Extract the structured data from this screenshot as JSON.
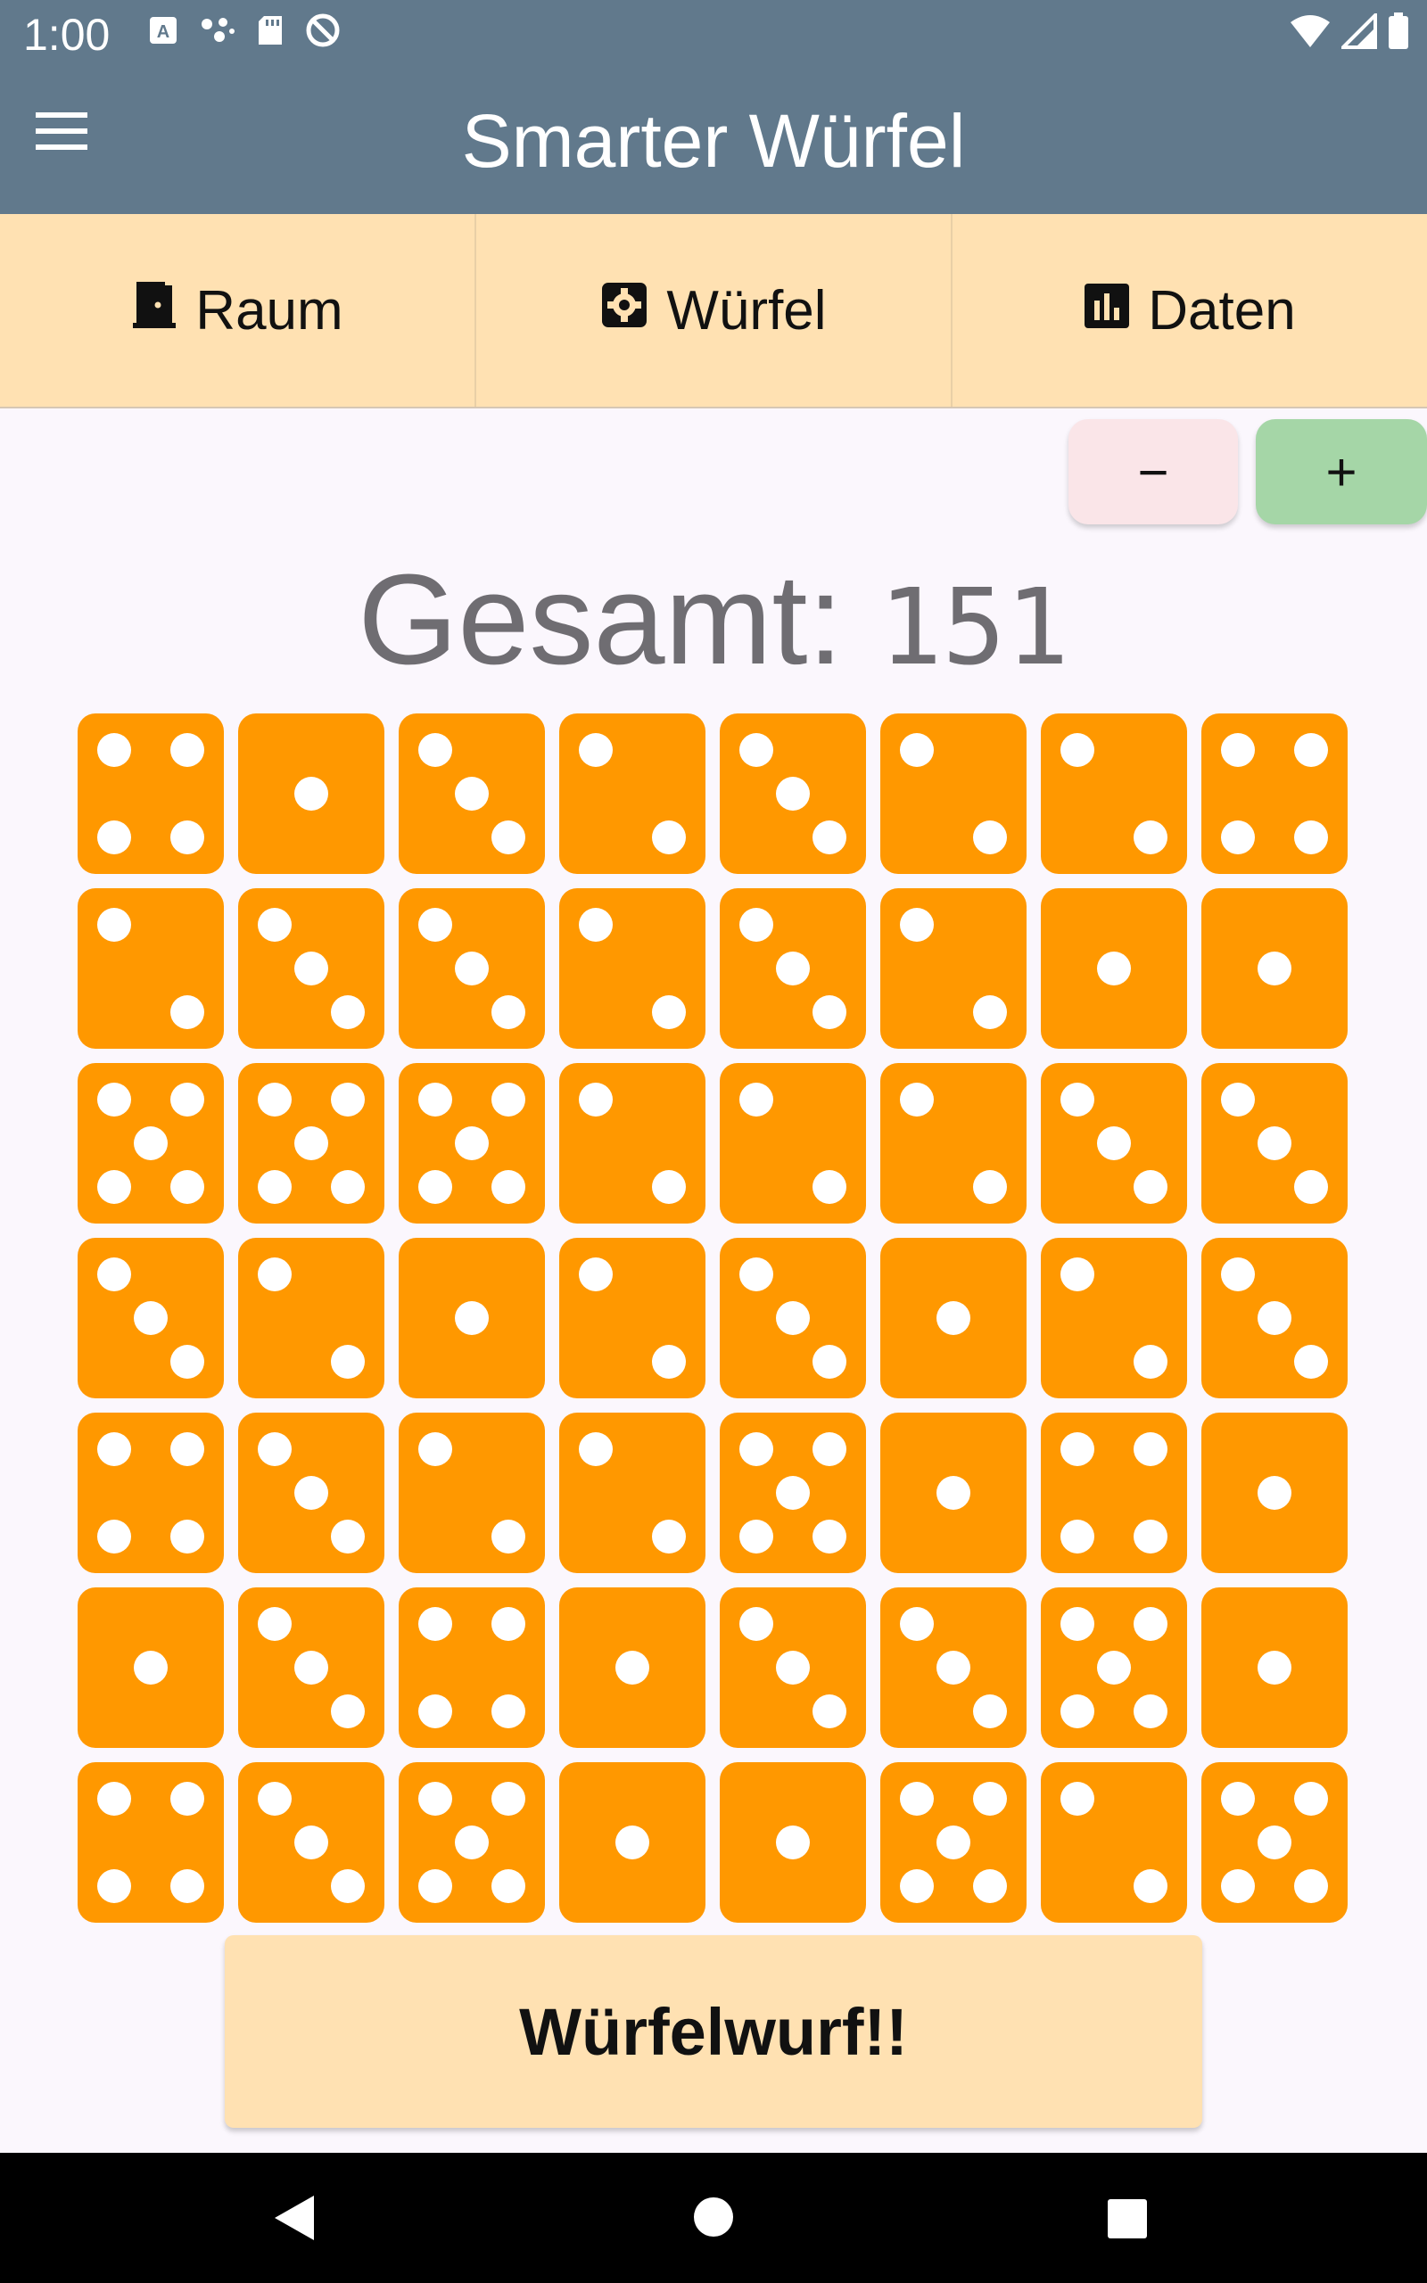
{
  "status_bar": {
    "time": "1:00"
  },
  "app_bar": {
    "title": "Smarter Würfel"
  },
  "tabs": [
    {
      "label": "Raum",
      "icon": "door-icon"
    },
    {
      "label": "Würfel",
      "icon": "die-gear-icon"
    },
    {
      "label": "Daten",
      "icon": "bar-chart-icon"
    }
  ],
  "controls": {
    "minus_label": "−",
    "plus_label": "+"
  },
  "total": {
    "label": "Gesamt:",
    "value": "151"
  },
  "dice": [
    [
      4,
      1,
      3,
      2,
      3,
      2,
      2,
      4
    ],
    [
      2,
      3,
      3,
      2,
      3,
      2,
      1,
      1
    ],
    [
      5,
      5,
      5,
      2,
      2,
      2,
      3,
      3
    ],
    [
      3,
      2,
      1,
      2,
      3,
      1,
      2,
      3
    ],
    [
      4,
      3,
      2,
      2,
      5,
      1,
      4,
      1
    ],
    [
      1,
      3,
      4,
      1,
      3,
      3,
      5,
      1
    ],
    [
      4,
      3,
      5,
      1,
      1,
      5,
      2,
      5
    ]
  ],
  "roll_button": {
    "label": "Würfelwurf!!"
  },
  "colors": {
    "app_bar": "#61798C",
    "tab_bar": "#FFE1B2",
    "die": "#FF9800",
    "pip": "#FFFFFF",
    "minus_button": "#FAE5E8",
    "plus_button": "#A5D6A7",
    "total_text": "#6f6d72"
  }
}
